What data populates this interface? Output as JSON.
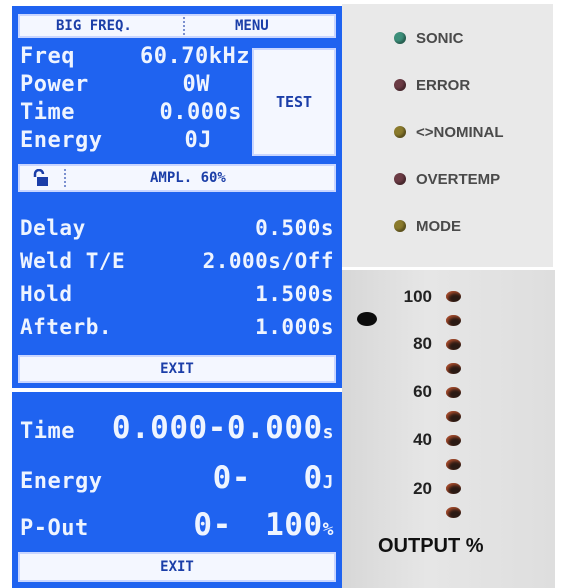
{
  "screen1": {
    "header_left": "BIG FREQ.",
    "header_right": "MENU",
    "rows": [
      {
        "label": "Freq",
        "value": "60.70kHz"
      },
      {
        "label": "Power",
        "value": "0W"
      },
      {
        "label": "Time",
        "value": "0.000s"
      },
      {
        "label": "Energy",
        "value": "0J"
      }
    ],
    "test_label": "TEST",
    "ampl_label": "AMPL. 60%",
    "lock_icon": "unlock-icon"
  },
  "screen2": {
    "rows": [
      {
        "label": "Delay",
        "value": "0.500s"
      },
      {
        "label": "Weld T/E",
        "value": "2.000s/Off"
      },
      {
        "label": "Hold",
        "value": "1.500s"
      },
      {
        "label": "Afterb.",
        "value": "1.000s"
      }
    ],
    "exit_label": "EXIT"
  },
  "screen3": {
    "rows": [
      {
        "label": "Time",
        "value_a": "0.000-",
        "value_b": "0.000",
        "unit": "s"
      },
      {
        "label": "Energy",
        "value_a": "0-",
        "value_b": "0",
        "unit": "J"
      },
      {
        "label": "P-Out",
        "value_a": "0-",
        "value_b": "100",
        "unit": "%"
      }
    ],
    "exit_label": "EXIT"
  },
  "status_leds": [
    {
      "label": "SONIC",
      "color": "#3d8f7a"
    },
    {
      "label": "ERROR",
      "color": "#6b3b44"
    },
    {
      "label": "<>NOMINAL",
      "color": "#8a7a2c"
    },
    {
      "label": "OVERTEMP",
      "color": "#6b3b44"
    },
    {
      "label": "MODE",
      "color": "#8a7a2c"
    }
  ],
  "output": {
    "scale_labels": [
      "100",
      "80",
      "60",
      "40",
      "20"
    ],
    "title": "OUTPUT %"
  }
}
